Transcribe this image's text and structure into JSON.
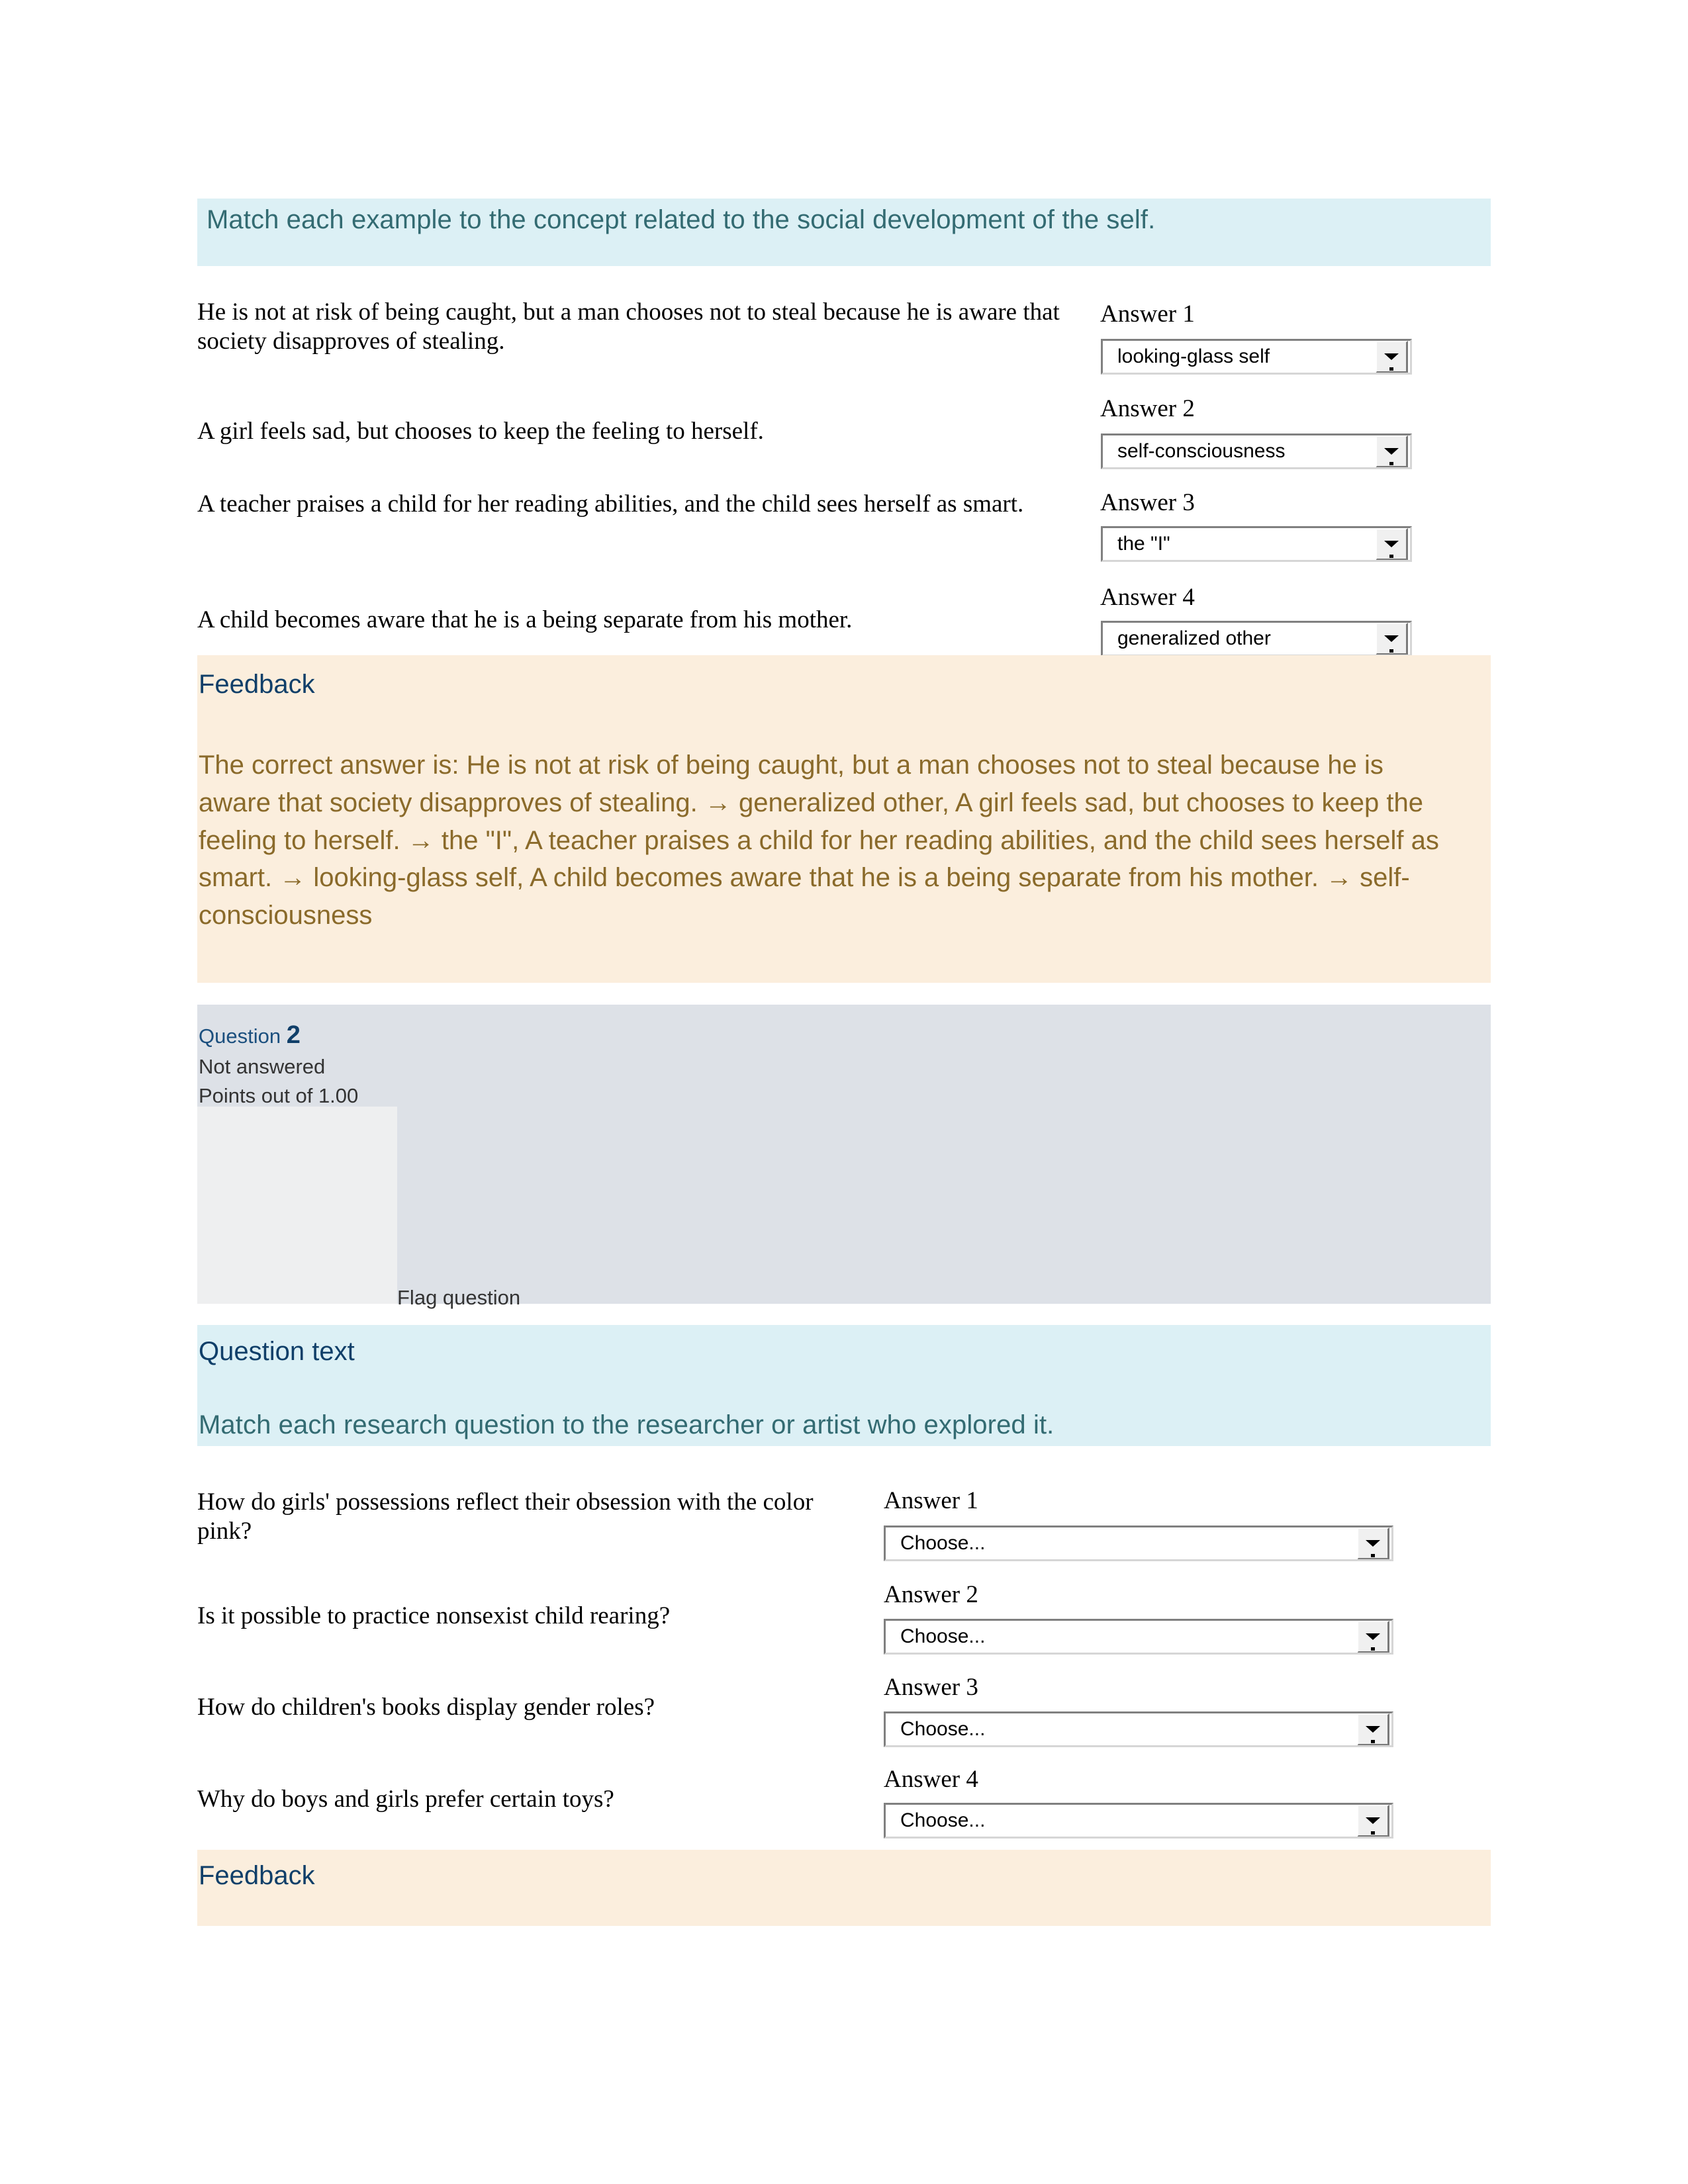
{
  "question1": {
    "prompt": "Match each example to the concept related to the social development of the self.",
    "stems": [
      "He is not at risk of being caught, but a man chooses not to steal because he is aware that society disapproves of stealing.",
      "A girl feels sad, but chooses to keep the feeling to herself.",
      "A teacher praises a child for her reading abilities, and the child sees herself as smart.",
      "A child becomes aware that he is a being separate from his mother."
    ],
    "answers": [
      {
        "label": "Answer 1",
        "value": "looking-glass self"
      },
      {
        "label": "Answer 2",
        "value": "self-consciousness"
      },
      {
        "label": "Answer 3",
        "value": "the \"I\""
      },
      {
        "label": "Answer 4",
        "value": "generalized other"
      }
    ],
    "feedback_heading": "Feedback",
    "feedback_text": "The correct answer is: He is not at risk of being caught, but a man chooses not to steal because he is aware that society disapproves of stealing. → generalized other, A girl feels sad, but chooses to keep the feeling to herself. → the \"I\", A teacher praises a child for her reading abilities, and the child sees herself as smart. → looking-glass self, A child becomes aware that he is a being separate from his mother. → self-consciousness"
  },
  "question2": {
    "number_label": "Question",
    "number": "2",
    "status": "Not answered",
    "points": "Points out of 1.00",
    "flag_label": "Flag question",
    "question_text_heading": "Question text",
    "prompt": "Match each research question to the researcher or artist who explored it.",
    "stems": [
      "How do girls' possessions reflect their obsession with the color pink?",
      "Is it possible to practice nonsexist child rearing?",
      "How do children's books display gender roles?",
      "Why do boys and girls prefer certain toys?"
    ],
    "answers": [
      {
        "label": "Answer 1",
        "value": "Choose..."
      },
      {
        "label": "Answer 2",
        "value": "Choose..."
      },
      {
        "label": "Answer 3",
        "value": "Choose..."
      },
      {
        "label": "Answer 4",
        "value": "Choose..."
      }
    ],
    "feedback_heading": "Feedback"
  },
  "colors": {
    "band_teal": "#dcf0f5",
    "band_cream": "#fbeedd",
    "band_grey": "#dde1e7",
    "teal_text": "#336b72",
    "navy_text": "#103f69",
    "feedback_text": "#8a6a2a"
  }
}
